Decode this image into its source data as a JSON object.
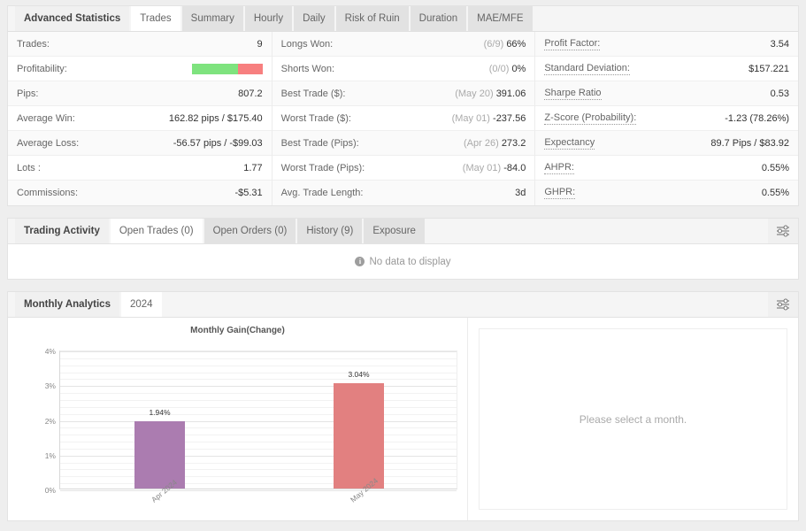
{
  "stats_panel": {
    "title": "Advanced Statistics",
    "tabs": [
      {
        "label": "Trades",
        "active": true
      },
      {
        "label": "Summary",
        "active": false
      },
      {
        "label": "Hourly",
        "active": false
      },
      {
        "label": "Daily",
        "active": false
      },
      {
        "label": "Risk of Ruin",
        "active": false
      },
      {
        "label": "Duration",
        "active": false
      },
      {
        "label": "MAE/MFE",
        "active": false
      }
    ],
    "columns": [
      {
        "rows": [
          {
            "label": "Trades:",
            "value": "9",
            "muted": "",
            "type": "text",
            "dotted": false
          },
          {
            "label": "Profitability:",
            "value": "",
            "muted": "",
            "type": "bar",
            "dotted": false,
            "win_pct": 66,
            "loss_pct": 34
          },
          {
            "label": "Pips:",
            "value": "807.2",
            "muted": "",
            "type": "text",
            "dotted": false
          },
          {
            "label": "Average Win:",
            "value": "162.82 pips / $175.40",
            "muted": "",
            "type": "text",
            "dotted": false
          },
          {
            "label": "Average Loss:",
            "value": "-56.57 pips / -$99.03",
            "muted": "",
            "type": "text",
            "dotted": false
          },
          {
            "label": "Lots :",
            "value": "1.77",
            "muted": "",
            "type": "text",
            "dotted": false
          },
          {
            "label": "Commissions:",
            "value": "-$5.31",
            "muted": "",
            "type": "text",
            "dotted": false
          }
        ]
      },
      {
        "rows": [
          {
            "label": "Longs Won:",
            "value": "66%",
            "muted": "(6/9)",
            "type": "text",
            "dotted": false
          },
          {
            "label": "Shorts Won:",
            "value": "0%",
            "muted": "(0/0)",
            "type": "text",
            "dotted": false
          },
          {
            "label": "Best Trade ($):",
            "value": "391.06",
            "muted": "(May 20)",
            "type": "text",
            "dotted": false
          },
          {
            "label": "Worst Trade ($):",
            "value": "-237.56",
            "muted": "(May 01)",
            "type": "text",
            "dotted": false
          },
          {
            "label": "Best Trade (Pips):",
            "value": "273.2",
            "muted": "(Apr 26)",
            "type": "text",
            "dotted": false
          },
          {
            "label": "Worst Trade (Pips):",
            "value": "-84.0",
            "muted": "(May 01)",
            "type": "text",
            "dotted": false
          },
          {
            "label": "Avg. Trade Length:",
            "value": "3d",
            "muted": "",
            "type": "text",
            "dotted": false
          }
        ]
      },
      {
        "rows": [
          {
            "label": "Profit Factor:",
            "value": "3.54",
            "muted": "",
            "type": "text",
            "dotted": true
          },
          {
            "label": "Standard Deviation:",
            "value": "$157.221",
            "muted": "",
            "type": "text",
            "dotted": true
          },
          {
            "label": "Sharpe Ratio",
            "value": "0.53",
            "muted": "",
            "type": "text",
            "dotted": true
          },
          {
            "label": "Z-Score (Probability):",
            "value": "-1.23 (78.26%)",
            "muted": "",
            "type": "text",
            "dotted": true
          },
          {
            "label": "Expectancy",
            "value": "89.7 Pips / $83.92",
            "muted": "",
            "type": "text",
            "dotted": true
          },
          {
            "label": "AHPR:",
            "value": "0.55%",
            "muted": "",
            "type": "text",
            "dotted": true
          },
          {
            "label": "GHPR:",
            "value": "0.55%",
            "muted": "",
            "type": "text",
            "dotted": true
          }
        ]
      }
    ]
  },
  "activity_panel": {
    "title": "Trading Activity",
    "tabs": [
      {
        "label": "Open Trades (0)",
        "active": true
      },
      {
        "label": "Open Orders (0)",
        "active": false
      },
      {
        "label": "History (9)",
        "active": false
      },
      {
        "label": "Exposure",
        "active": false
      }
    ],
    "settings_icon": "sliders-icon",
    "empty_message": "No data to display",
    "empty_icon": "info-icon"
  },
  "monthly_panel": {
    "title": "Monthly Analytics",
    "tabs": [
      {
        "label": "2024",
        "active": true
      }
    ],
    "settings_icon": "sliders-icon",
    "side_message": "Please select a month."
  },
  "chart_data": {
    "type": "bar",
    "title": "Monthly Gain(Change)",
    "xlabel": "",
    "ylabel": "",
    "categories": [
      "Apr 2024",
      "May 2024"
    ],
    "values": [
      1.94,
      3.04
    ],
    "value_labels": [
      "1.94%",
      "3.04%"
    ],
    "colors": [
      "#ab7cb0",
      "#e28080"
    ],
    "ylim": [
      0,
      4
    ],
    "yticks": [
      0,
      1,
      2,
      3,
      4
    ],
    "ytick_labels": [
      "0%",
      "1%",
      "2%",
      "3%",
      "4%"
    ],
    "minor_ticks_per_major": 5,
    "grid": true,
    "legend": false
  },
  "colors": {
    "win_green": "#7ee37e",
    "loss_red": "#f77f7f",
    "bar_purple": "#ab7cb0",
    "bar_salmon": "#e28080",
    "page_bg": "#eeeeee"
  }
}
